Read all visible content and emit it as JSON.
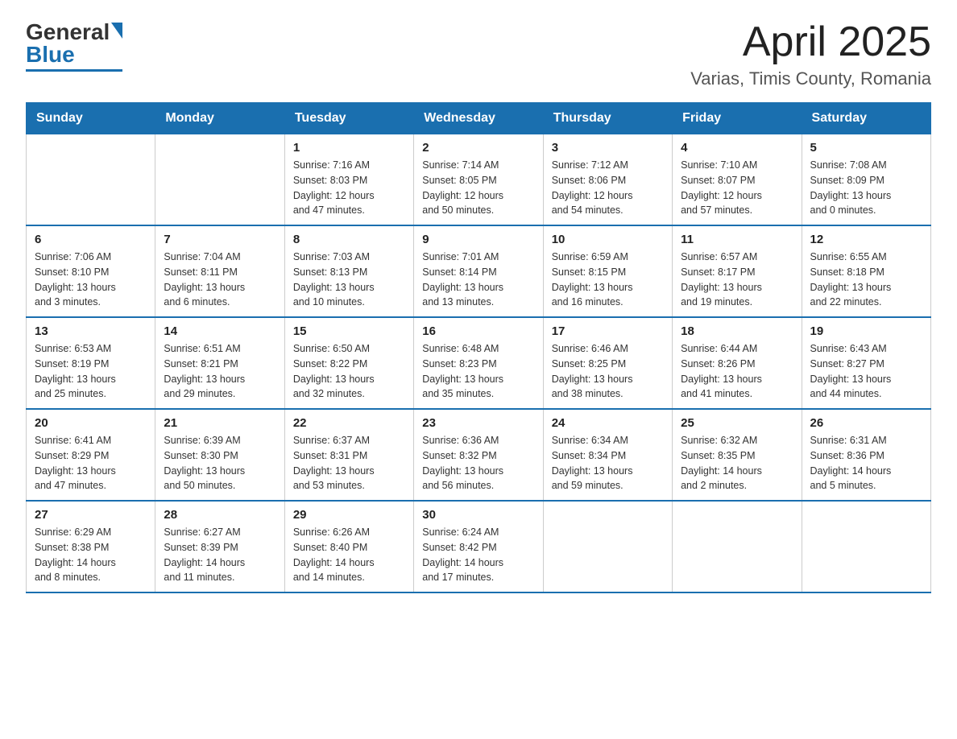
{
  "logo": {
    "general": "General",
    "blue": "Blue"
  },
  "header": {
    "title": "April 2025",
    "location": "Varias, Timis County, Romania"
  },
  "days_of_week": [
    "Sunday",
    "Monday",
    "Tuesday",
    "Wednesday",
    "Thursday",
    "Friday",
    "Saturday"
  ],
  "weeks": [
    [
      {
        "day": "",
        "info": ""
      },
      {
        "day": "",
        "info": ""
      },
      {
        "day": "1",
        "info": "Sunrise: 7:16 AM\nSunset: 8:03 PM\nDaylight: 12 hours\nand 47 minutes."
      },
      {
        "day": "2",
        "info": "Sunrise: 7:14 AM\nSunset: 8:05 PM\nDaylight: 12 hours\nand 50 minutes."
      },
      {
        "day": "3",
        "info": "Sunrise: 7:12 AM\nSunset: 8:06 PM\nDaylight: 12 hours\nand 54 minutes."
      },
      {
        "day": "4",
        "info": "Sunrise: 7:10 AM\nSunset: 8:07 PM\nDaylight: 12 hours\nand 57 minutes."
      },
      {
        "day": "5",
        "info": "Sunrise: 7:08 AM\nSunset: 8:09 PM\nDaylight: 13 hours\nand 0 minutes."
      }
    ],
    [
      {
        "day": "6",
        "info": "Sunrise: 7:06 AM\nSunset: 8:10 PM\nDaylight: 13 hours\nand 3 minutes."
      },
      {
        "day": "7",
        "info": "Sunrise: 7:04 AM\nSunset: 8:11 PM\nDaylight: 13 hours\nand 6 minutes."
      },
      {
        "day": "8",
        "info": "Sunrise: 7:03 AM\nSunset: 8:13 PM\nDaylight: 13 hours\nand 10 minutes."
      },
      {
        "day": "9",
        "info": "Sunrise: 7:01 AM\nSunset: 8:14 PM\nDaylight: 13 hours\nand 13 minutes."
      },
      {
        "day": "10",
        "info": "Sunrise: 6:59 AM\nSunset: 8:15 PM\nDaylight: 13 hours\nand 16 minutes."
      },
      {
        "day": "11",
        "info": "Sunrise: 6:57 AM\nSunset: 8:17 PM\nDaylight: 13 hours\nand 19 minutes."
      },
      {
        "day": "12",
        "info": "Sunrise: 6:55 AM\nSunset: 8:18 PM\nDaylight: 13 hours\nand 22 minutes."
      }
    ],
    [
      {
        "day": "13",
        "info": "Sunrise: 6:53 AM\nSunset: 8:19 PM\nDaylight: 13 hours\nand 25 minutes."
      },
      {
        "day": "14",
        "info": "Sunrise: 6:51 AM\nSunset: 8:21 PM\nDaylight: 13 hours\nand 29 minutes."
      },
      {
        "day": "15",
        "info": "Sunrise: 6:50 AM\nSunset: 8:22 PM\nDaylight: 13 hours\nand 32 minutes."
      },
      {
        "day": "16",
        "info": "Sunrise: 6:48 AM\nSunset: 8:23 PM\nDaylight: 13 hours\nand 35 minutes."
      },
      {
        "day": "17",
        "info": "Sunrise: 6:46 AM\nSunset: 8:25 PM\nDaylight: 13 hours\nand 38 minutes."
      },
      {
        "day": "18",
        "info": "Sunrise: 6:44 AM\nSunset: 8:26 PM\nDaylight: 13 hours\nand 41 minutes."
      },
      {
        "day": "19",
        "info": "Sunrise: 6:43 AM\nSunset: 8:27 PM\nDaylight: 13 hours\nand 44 minutes."
      }
    ],
    [
      {
        "day": "20",
        "info": "Sunrise: 6:41 AM\nSunset: 8:29 PM\nDaylight: 13 hours\nand 47 minutes."
      },
      {
        "day": "21",
        "info": "Sunrise: 6:39 AM\nSunset: 8:30 PM\nDaylight: 13 hours\nand 50 minutes."
      },
      {
        "day": "22",
        "info": "Sunrise: 6:37 AM\nSunset: 8:31 PM\nDaylight: 13 hours\nand 53 minutes."
      },
      {
        "day": "23",
        "info": "Sunrise: 6:36 AM\nSunset: 8:32 PM\nDaylight: 13 hours\nand 56 minutes."
      },
      {
        "day": "24",
        "info": "Sunrise: 6:34 AM\nSunset: 8:34 PM\nDaylight: 13 hours\nand 59 minutes."
      },
      {
        "day": "25",
        "info": "Sunrise: 6:32 AM\nSunset: 8:35 PM\nDaylight: 14 hours\nand 2 minutes."
      },
      {
        "day": "26",
        "info": "Sunrise: 6:31 AM\nSunset: 8:36 PM\nDaylight: 14 hours\nand 5 minutes."
      }
    ],
    [
      {
        "day": "27",
        "info": "Sunrise: 6:29 AM\nSunset: 8:38 PM\nDaylight: 14 hours\nand 8 minutes."
      },
      {
        "day": "28",
        "info": "Sunrise: 6:27 AM\nSunset: 8:39 PM\nDaylight: 14 hours\nand 11 minutes."
      },
      {
        "day": "29",
        "info": "Sunrise: 6:26 AM\nSunset: 8:40 PM\nDaylight: 14 hours\nand 14 minutes."
      },
      {
        "day": "30",
        "info": "Sunrise: 6:24 AM\nSunset: 8:42 PM\nDaylight: 14 hours\nand 17 minutes."
      },
      {
        "day": "",
        "info": ""
      },
      {
        "day": "",
        "info": ""
      },
      {
        "day": "",
        "info": ""
      }
    ]
  ]
}
